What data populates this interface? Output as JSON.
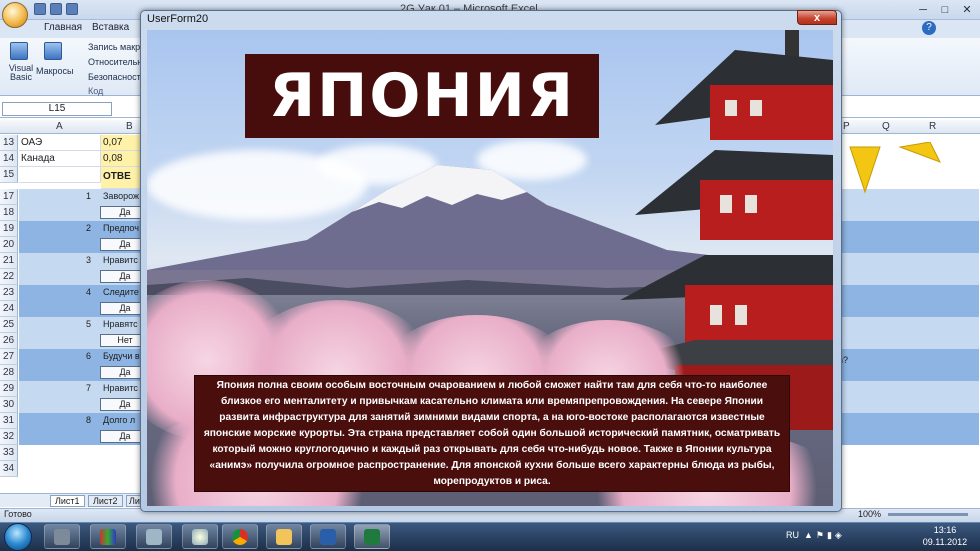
{
  "excel": {
    "window_title": "2G Уак 01 – Microsoft Excel",
    "ribbon_tabs": [
      "Главная",
      "Вставка"
    ],
    "ribbon": {
      "visual_basic": "Visual\nBasic",
      "macros": "Макросы",
      "record_macro": "Запись макро",
      "relative": "Относительн",
      "security": "Безопасность",
      "group_label": "Код"
    },
    "name_box": "L15",
    "columns": [
      "A",
      "B",
      "P",
      "Q",
      "R"
    ],
    "rows": [
      {
        "n": "13",
        "a": "ОАЭ",
        "b": "0,07"
      },
      {
        "n": "14",
        "a": "Канада",
        "b": "0,08"
      },
      {
        "n": "15",
        "a": "",
        "b": "ОТВЕ"
      },
      {
        "n": "17",
        "q": "1",
        "t": "Заворож"
      },
      {
        "n": "18",
        "ans": "Да"
      },
      {
        "n": "19",
        "q": "2",
        "t": "Предпоч"
      },
      {
        "n": "20",
        "ans": "Да"
      },
      {
        "n": "21",
        "q": "3",
        "t": "Нравитс"
      },
      {
        "n": "22",
        "ans": "Да"
      },
      {
        "n": "23",
        "q": "4",
        "t": "Следите"
      },
      {
        "n": "24",
        "ans": "Да"
      },
      {
        "n": "25",
        "q": "5",
        "t": "Нравятс"
      },
      {
        "n": "26",
        "ans": "Нет"
      },
      {
        "n": "27",
        "q": "6",
        "t": "Будучи в"
      },
      {
        "n": "28",
        "ans": "Да"
      },
      {
        "n": "29",
        "q": "7",
        "t": "Нравитс"
      },
      {
        "n": "30",
        "ans": "Да"
      },
      {
        "n": "31",
        "q": "8",
        "t": "Долго л"
      },
      {
        "n": "32",
        "ans": "Да"
      },
      {
        "n": "33"
      },
      {
        "n": "34"
      }
    ],
    "right_cell_fragment": "n?",
    "sheet_tabs": [
      "Лист1",
      "Лист2",
      "Ли"
    ],
    "status": "Готово",
    "zoom": "100%"
  },
  "userform": {
    "title": "UserForm20",
    "close": "x",
    "heading": "ЯПОНИЯ",
    "body": "Япония полна своим особым восточным очарованием и любой сможет найти там для себя что-то наиболее близкое его менталитету и привычкам касательно климата или времяпрепровождения. На севере Японии развита инфраструктура для занятий зимними видами спорта, а на юго-востоке располагаются известные японские морские курорты. Эта страна представляет собой один большой исторический памятник, осматривать который можно круглогодично и каждый раз открывать для себя что-нибудь новое. Также в Японии культура «анимэ» получила огромное распространение. Для японской кухни больше всего характерны блюда из рыбы, морепродуктов и риса."
  },
  "taskbar": {
    "language": "RU",
    "time": "13:16",
    "date": "09.11.2012"
  },
  "colors": {
    "title_box_bg": "#470d0c",
    "text_box_bg": "#4a0e0d",
    "answer_yellow": "#fff2a8",
    "row_blue_dark": "#8db4e2",
    "row_blue_light": "#c5d9f1"
  }
}
